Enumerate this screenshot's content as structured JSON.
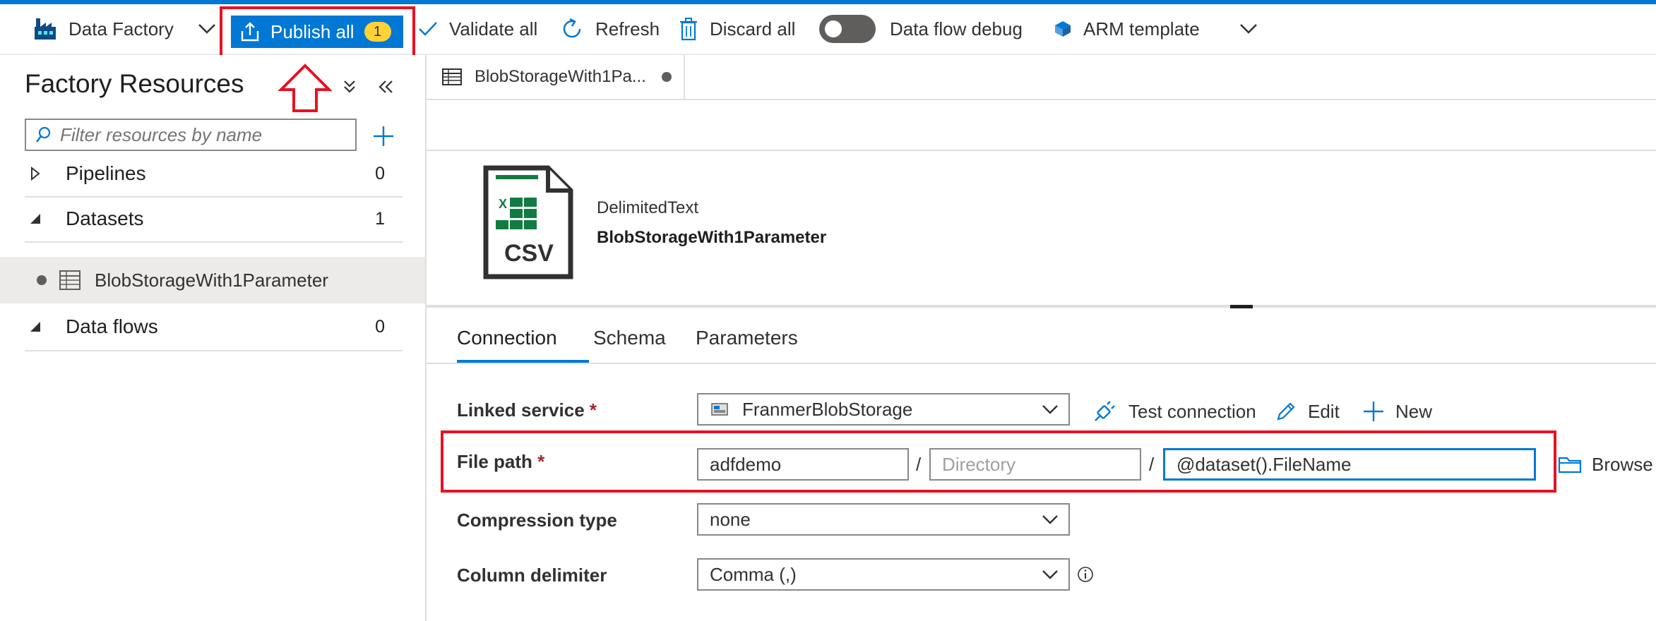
{
  "toolbar": {
    "factory_label": "Data Factory",
    "publish_label": "Publish all",
    "publish_badge": "1",
    "validate_label": "Validate all",
    "refresh_label": "Refresh",
    "discard_label": "Discard all",
    "debug_label": "Data flow debug",
    "arm_label": "ARM template"
  },
  "left": {
    "title": "Factory Resources",
    "search_placeholder": "Filter resources by name",
    "groups": [
      {
        "label": "Pipelines",
        "count": "0"
      },
      {
        "label": "Datasets",
        "count": "1"
      },
      {
        "label": "Data flows",
        "count": "0"
      }
    ],
    "selected_dataset": "BlobStorageWith1Parameter"
  },
  "tab": {
    "title": "BlobStorageWith1Pa..."
  },
  "dataset": {
    "type": "DelimitedText",
    "name": "BlobStorageWith1Parameter",
    "icon_text": "CSV"
  },
  "subtabs": [
    "Connection",
    "Schema",
    "Parameters"
  ],
  "form": {
    "linked_service_label": "Linked service",
    "linked_service_value": "FranmerBlobStorage",
    "test_connection": "Test connection",
    "edit": "Edit",
    "new": "New",
    "file_path_label": "File path",
    "container_value": "adfdemo",
    "directory_placeholder": "Directory",
    "filename_value": "@dataset().FileName",
    "browse": "Browse",
    "compression_label": "Compression type",
    "compression_value": "none",
    "delimiter_label": "Column delimiter",
    "delimiter_value": "Comma (,)",
    "required_mark": "*",
    "separator": "/"
  },
  "colors": {
    "accent": "#0078d4",
    "highlight": "#e81123",
    "badge": "#ffd335"
  }
}
